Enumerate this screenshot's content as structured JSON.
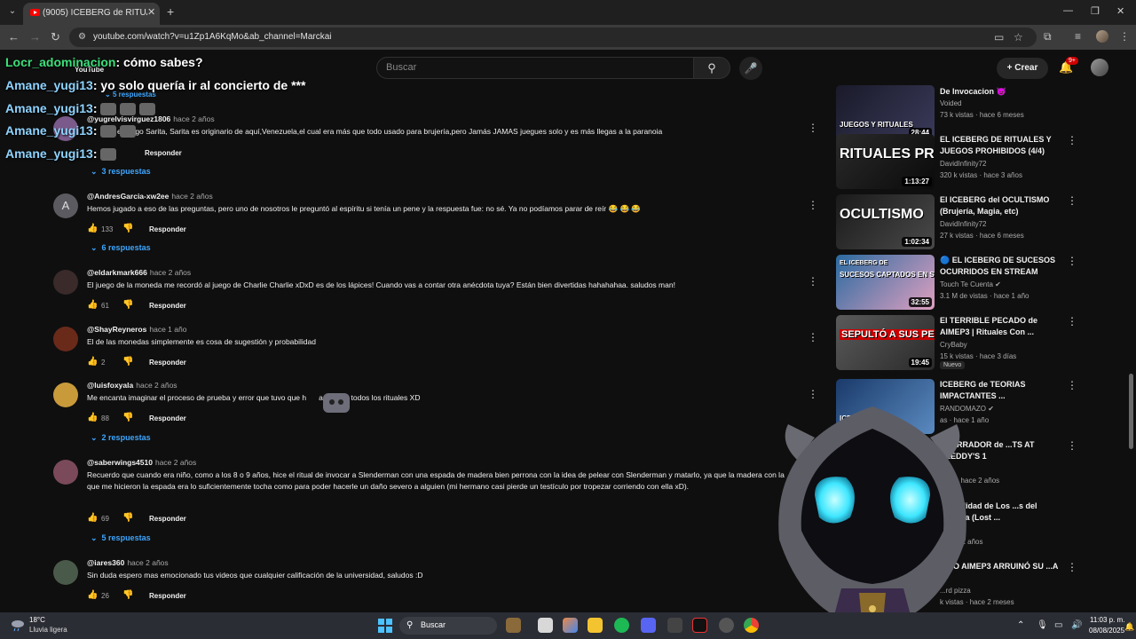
{
  "browser": {
    "tab_title": "(9005) ICEBERG de RITUALES y",
    "url": "youtube.com/watch?v=u1Zp1A6KqMo&ab_channel=Marckai"
  },
  "yt": {
    "search_placeholder": "Buscar",
    "create_label": "Crear",
    "notif_badge": "9+",
    "logo_text": "YouTube"
  },
  "chat": [
    {
      "user": "Locr_adominacion",
      "message": ": cómo sabes?"
    },
    {
      "user": "Amane_yugi13",
      "message": ": yo solo quería ir al concierto de ***"
    },
    {
      "user": "Amane_yugi13",
      "message": ":"
    },
    {
      "user": "Amane_yugi13",
      "message": ":"
    },
    {
      "user": "Amane_yugi13",
      "message": ":"
    }
  ],
  "top_partial": {
    "replies_label": "5 respuestas",
    "author": "@yugrelvisvirguez1806",
    "time": "hace 2 años",
    "text": "el juego Sarita, Sarita es originario de aquí,Venezuela,el cual era más que todo usado para brujería,pero Jamás JAMAS juegues solo y es más llegas a la paranoia",
    "text_prefix": "el",
    "text_mid": "ad,",
    "reply": "Responder",
    "replies": "3 respuestas"
  },
  "comments": [
    {
      "author": "@AndresGarcia-xw2ee",
      "time": "hace 2 años",
      "text": "Hemos jugado a eso de las preguntas, pero uno de nosotros le preguntó al espíritu si tenía un pene y la respuesta fue: no sé. Ya no podíamos parar de reír 😂 😂 😂",
      "likes": "133",
      "reply": "Responder",
      "replies": "6 respuestas",
      "avatar_letter": "A"
    },
    {
      "author": "@eldarkmark666",
      "time": "hace 2 años",
      "text": "El juego de la moneda me recordó al juego de Charlie Charlie xDxD es de los lápices! Cuando vas a contar otra anécdota tuya? Están bien divertidas hahahahaa. saludos man!",
      "likes": "61",
      "reply": "Responder"
    },
    {
      "author": "@ShayReyneros",
      "time": "hace 1 año",
      "text": "El de las monedas simplemente es cosa de sugestión y probabilidad",
      "likes": "2",
      "reply": "Responder"
    },
    {
      "author": "@luisfoxyala",
      "time": "hace 2 años",
      "text_a": "Me encanta imaginar el proceso de prueba y error que tuvo que h",
      "text_b": "ara crear todos los rituales XD",
      "likes": "88",
      "reply": "Responder",
      "replies": "2 respuestas"
    },
    {
      "author": "@saberwings4510",
      "time": "hace 2 años",
      "text": "Recuerdo que cuando era niño, como a los 8 o 9 años, hice el ritual de invocar a Slenderman con una espada de madera bien perrona con la idea de pelear con Slenderman y matarlo, ya que la madera con la que me hicieron la espada era lo suficientemente tocha como para poder hacerle un daño severo a alguien (mi hermano casi pierde un testículo por tropezar corriendo con ella xD).",
      "likes": "69",
      "reply": "Responder",
      "replies": "5 respuestas"
    },
    {
      "author": "@iares360",
      "time": "hace 2 años",
      "text": "Sin duda espero mas emocionado tus videos que cualquier calificación de la universidad, saludos :D",
      "likes": "26",
      "reply": "Responder"
    }
  ],
  "recommendations": [
    {
      "title": "De Invocacion 👿",
      "channel": "Voided",
      "meta": "73 k vistas · hace 6 meses",
      "duration": "28:44",
      "thumb_text": "JUEGOS Y RITUALES"
    },
    {
      "title": "EL ICEBERG DE RITUALES Y JUEGOS PROHIBIDOS (4/4)",
      "channel": "DavidInfinity72",
      "meta": "320 k vistas · hace 3 años",
      "duration": "1:13:27",
      "thumb_text": "RITUALES PROHIBIDOS"
    },
    {
      "title": "El ICEBERG del OCULTISMO (Brujería, Magia, etc)",
      "channel": "DavidInfinity72",
      "meta": "27 k vistas · hace 6 meses",
      "duration": "1:02:34",
      "thumb_text": "OCULTISMO"
    },
    {
      "title": "🔵 EL ICEBERG DE SUCESOS OCURRIDOS EN STREAM",
      "channel": "Touch Te Cuenta ✔",
      "meta": "3.1 M de vistas · hace 1 año",
      "duration": "32:55",
      "thumb_text": "SUCESOS CAPTADOS EN STREAM",
      "thumb_label": "EL ICEBERG DE"
    },
    {
      "title": "El TERRIBLE PECADO de AIMEP3 | Rituales Con ...",
      "channel": "CryBaby",
      "meta": "15 k vistas · hace 3 días",
      "duration": "19:45",
      "thumb_text": "SEPULTÓ A SUS PERROS",
      "badge": "Nuevo"
    },
    {
      "title": "ICEBERG de TEORIAS IMPACTANTES ...",
      "channel": "RANDOMAZO ✔",
      "meta": "as · hace 1 año",
      "duration": "",
      "thumb_text": "ICEBERG DE"
    },
    {
      "title": "...TERRADOR de ...TS AT FREDDY'S 1",
      "channel": "✔",
      "meta": "istas · hace 2 años",
      "duration": ""
    },
    {
      "title": "... Realidad de Los ...s del Mañana (Lost ...",
      "channel": "",
      "meta": "· hace 2 años",
      "duration": ""
    },
    {
      "title": "...MO AIMEP3 ARRUINÓ SU ...A",
      "channel": "...rd pizza",
      "meta": "k vistas · hace 2 meses",
      "duration": ""
    }
  ],
  "taskbar": {
    "temp": "18°C",
    "weather": "Lluvia ligera",
    "search": "Buscar",
    "time": "11:03 p. m.",
    "date": "08/08/2025"
  },
  "colors": {
    "bg": "#0f0f0f",
    "link_blue": "#3ea6ff",
    "chat_user": "#8fd3ff",
    "chat_user_alt": "#3be07b"
  }
}
